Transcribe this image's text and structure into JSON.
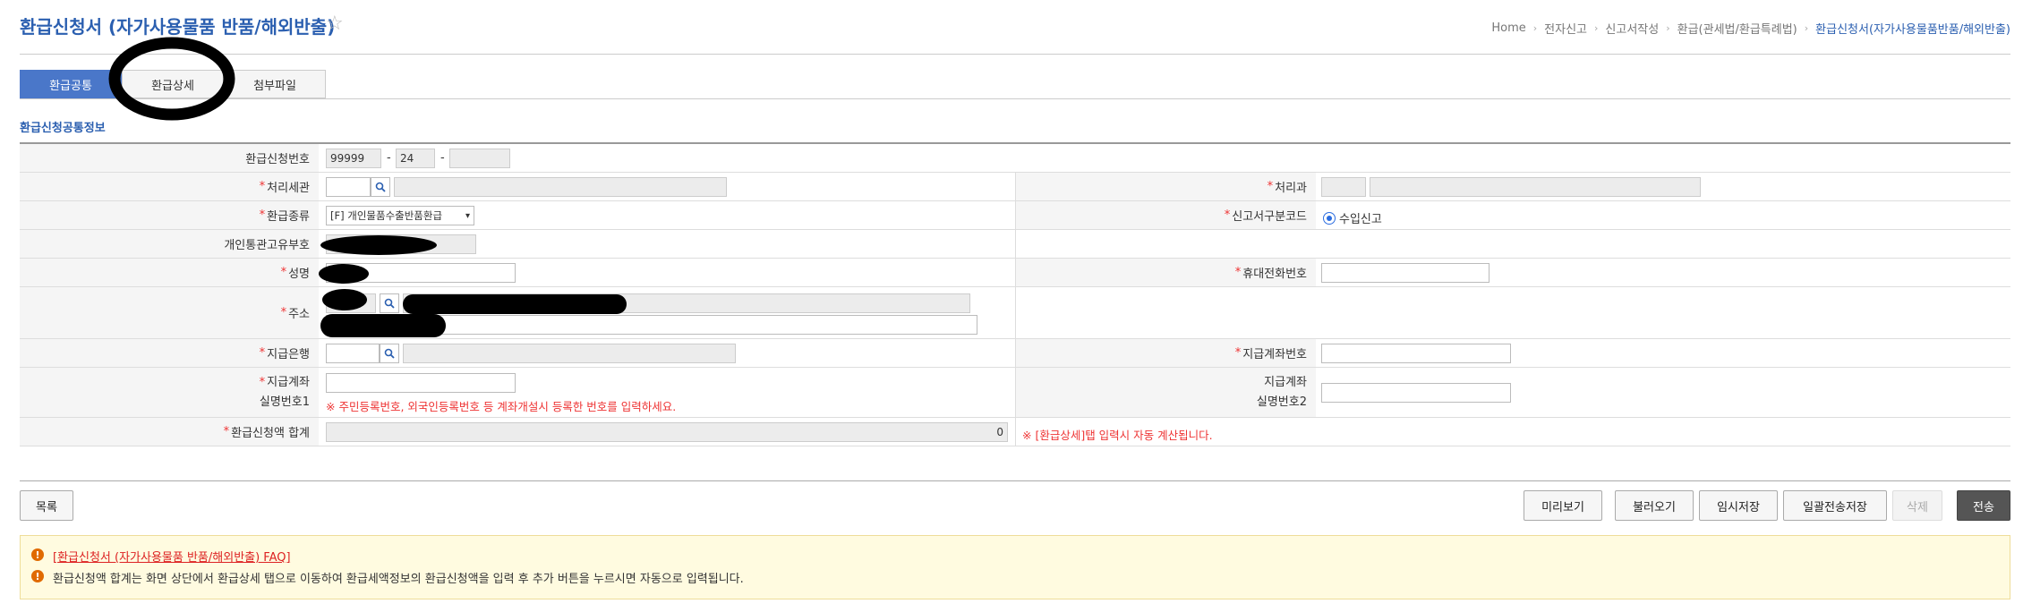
{
  "header": {
    "title": "환급신청서 (자가사용물품 반품/해외반출)",
    "breadcrumb": [
      "Home",
      "전자신고",
      "신고서작성",
      "환급(관세법/환급특례법)",
      "환급신청서(자가사용물품반품/해외반출)"
    ]
  },
  "tabs": [
    {
      "label": "환급공통"
    },
    {
      "label": "환급상세"
    },
    {
      "label": "첨부파일"
    }
  ],
  "section_title": "환급신청공통정보",
  "form": {
    "app_no_label": "환급신청번호",
    "app_no_part1": "99999",
    "app_no_part2": "24",
    "app_no_dash": "-",
    "customs_label": "처리세관",
    "dept_label": "처리과",
    "refund_type_label": "환급종류",
    "refund_type_value": "[F] 개인물품수출반품환급",
    "report_type_label": "신고서구분코드",
    "report_type_value": "수입신고",
    "pccc_label": "개인통관고유부호",
    "name_label": "성명",
    "mobile_label": "휴대전화번호",
    "address_label": "주소",
    "bank_label": "지급은행",
    "account_label": "지급계좌번호",
    "holder1_label_line1": "지급계좌",
    "holder1_label_line2": "실명번호1",
    "holder1_note": "※ 주민등록번호, 외국인등록번호 등 계좌개설시 등록한 번호를 입력하세요.",
    "holder2_label_line1": "지급계좌",
    "holder2_label_line2": "실명번호2",
    "total_label": "환급신청액 합계",
    "total_value": "0",
    "total_note": "※ [환급상세]탭 입력시 자동 계산됩니다."
  },
  "buttons": {
    "list": "목록",
    "preview": "미리보기",
    "load": "불러오기",
    "temp_save": "임시저장",
    "batch_save": "일괄전송저장",
    "delete": "삭제",
    "send": "전송"
  },
  "faq": {
    "link": "[환급신청서 (자가사용물품 반품/해외반출) FAQ]",
    "text": "환급신청액 합계는 화면 상단에서 환급상세 탭으로 이동하여 환급세액정보의 환급신청액을 입력 후 추가 버튼을 누르시면 자동으로 입력됩니다."
  },
  "colors": {
    "accent": "#2b5fb0",
    "tab_active": "#4a77c9",
    "required": "#ee3333"
  }
}
